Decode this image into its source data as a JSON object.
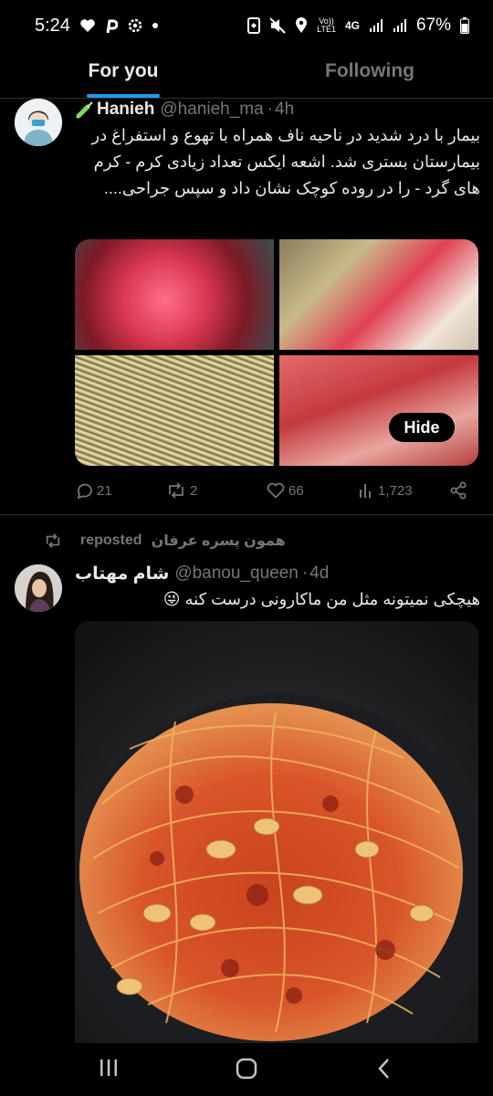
{
  "status_bar": {
    "time": "5:24",
    "left_icons": [
      "heart-icon",
      "pinterest-icon",
      "gear-icon",
      "dot-icon"
    ],
    "right_icons": [
      "nfc-icon",
      "mute-icon",
      "location-icon",
      "volte-icon",
      "4g-icon",
      "signal-icon",
      "signal-icon",
      "battery-icon"
    ],
    "volte_label_top": "Vo))",
    "volte_label_bottom": "LTE1",
    "network": "4G",
    "battery": "67%"
  },
  "tabs": [
    {
      "label": "For you",
      "active": true
    },
    {
      "label": "Following",
      "active": false
    }
  ],
  "tweets": [
    {
      "display_name": "Hanieh",
      "name_prefix_icon": "syringe-icon",
      "handle": "@hanieh_ma",
      "separator": "·",
      "time": "4h",
      "text": "بیمار با درد شدید در ناحیه ناف همراه با تهوع و استفراغ در بیمارستان بستری شد.  اشعه ایکس تعداد زیادی کرم - کرم های گرد - را در روده کوچک نشان داد و سپس جراحی....",
      "media_count": 4,
      "hide_label": "Hide",
      "actions": {
        "replies": "21",
        "reposts": "2",
        "likes": "66",
        "views": "1,723"
      }
    },
    {
      "repost_label": "reposted",
      "reposter_name": "همون پسره عرفان",
      "display_name": "شام مهتاب",
      "handle": "@banou_queen",
      "separator": "·",
      "time": "4d",
      "text": "هیچکی نمیتونه مثل من ماکارونی درست کنه",
      "emoji": "😜",
      "media_count": 1
    }
  ],
  "colors": {
    "accent": "#1d9bf0",
    "muted": "#71767b",
    "text": "#e7e9ea",
    "divider": "#2f3336",
    "background": "#000000"
  }
}
